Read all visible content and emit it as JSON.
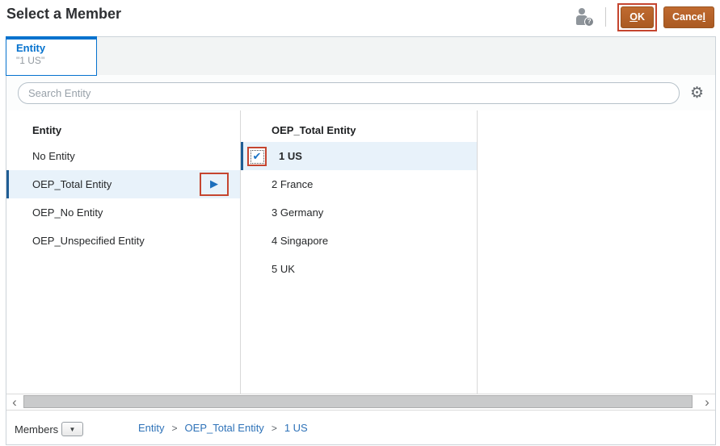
{
  "header": {
    "title": "Select a Member",
    "ok_underline": "O",
    "ok_rest": "K",
    "cancel_rest": "Cance",
    "cancel_underline": "l"
  },
  "tab": {
    "label": "Entity",
    "sublabel": "\"1 US\""
  },
  "search": {
    "placeholder": "Search Entity"
  },
  "columns": [
    {
      "header": "Entity",
      "items": [
        {
          "label": "No Entity",
          "selected": false
        },
        {
          "label": "OEP_Total Entity",
          "selected": true,
          "expandable": true
        },
        {
          "label": "OEP_No Entity",
          "selected": false
        },
        {
          "label": "OEP_Unspecified Entity",
          "selected": false
        }
      ]
    },
    {
      "header": "OEP_Total Entity",
      "items": [
        {
          "label": "1 US",
          "selected": true,
          "checked": true
        },
        {
          "label": "2 France",
          "selected": false
        },
        {
          "label": "3 Germany",
          "selected": false
        },
        {
          "label": "4 Singapore",
          "selected": false
        },
        {
          "label": "5 UK",
          "selected": false
        }
      ]
    }
  ],
  "footer": {
    "members_label": "Members",
    "separator": ">",
    "breadcrumb": [
      {
        "label": "Entity"
      },
      {
        "label": "OEP_Total Entity"
      },
      {
        "label": "1 US"
      }
    ]
  },
  "icons": {
    "member_help_badge": "?",
    "gear": "⚙",
    "expand_arrow": "▶",
    "check": "✔",
    "dropdown": "▼",
    "scroll_left": "‹",
    "scroll_right": "›"
  },
  "colors": {
    "accent_blue": "#0572ce",
    "selection_highlight": "#e8f2fa",
    "selection_bar": "#1f5d94",
    "button_orange": "#b56228",
    "annotation_red": "#c5452f"
  }
}
